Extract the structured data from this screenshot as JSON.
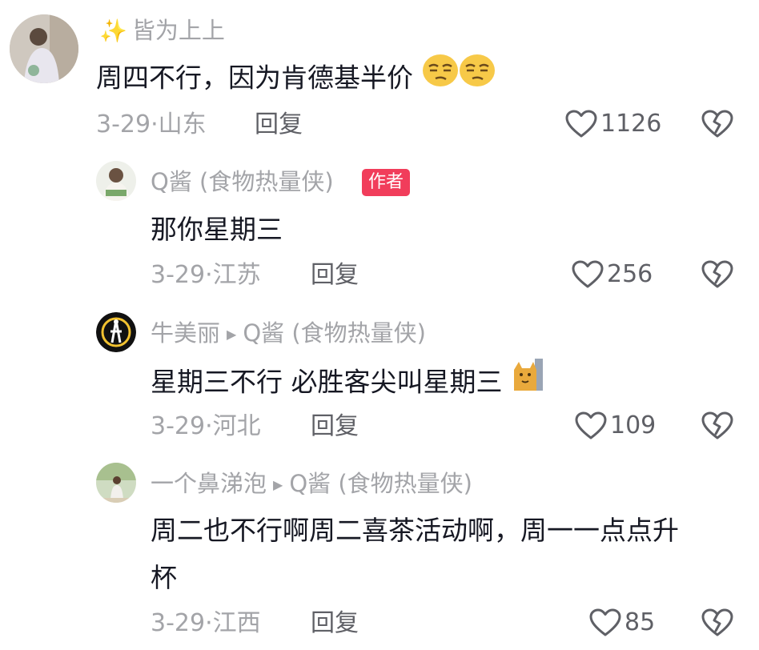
{
  "comments": [
    {
      "username": "皆为上上",
      "text": "周四不行，因为肯德基半价",
      "date": "3-29",
      "location": "山东",
      "reply_label": "回复",
      "likes": "1126"
    },
    {
      "username": "Q酱 (食物热量侠)",
      "badge": "作者",
      "text": "那你星期三",
      "date": "3-29",
      "location": "江苏",
      "reply_label": "回复",
      "likes": "256"
    },
    {
      "username": "牛美丽",
      "reply_to": "Q酱 (食物热量侠)",
      "text": "星期三不行 必胜客尖叫星期三",
      "date": "3-29",
      "location": "河北",
      "reply_label": "回复",
      "likes": "109"
    },
    {
      "username": "一个鼻涕泡",
      "reply_to": "Q酱 (食物热量侠)",
      "text_line1": "周二也不行啊周二喜茶活动啊，周一一点点升",
      "text_line2": "杯",
      "date": "3-29",
      "location": "江西",
      "reply_label": "回复",
      "likes": "85"
    }
  ],
  "icons": {
    "like": "heart-outline-icon",
    "dislike": "broken-heart-icon",
    "sparkle": "sparkles-emoji",
    "reply_arrow": "triangle-right-icon"
  },
  "colors": {
    "badge": "#f13d5b",
    "muted": "#a3a4a8",
    "text": "#161823"
  }
}
